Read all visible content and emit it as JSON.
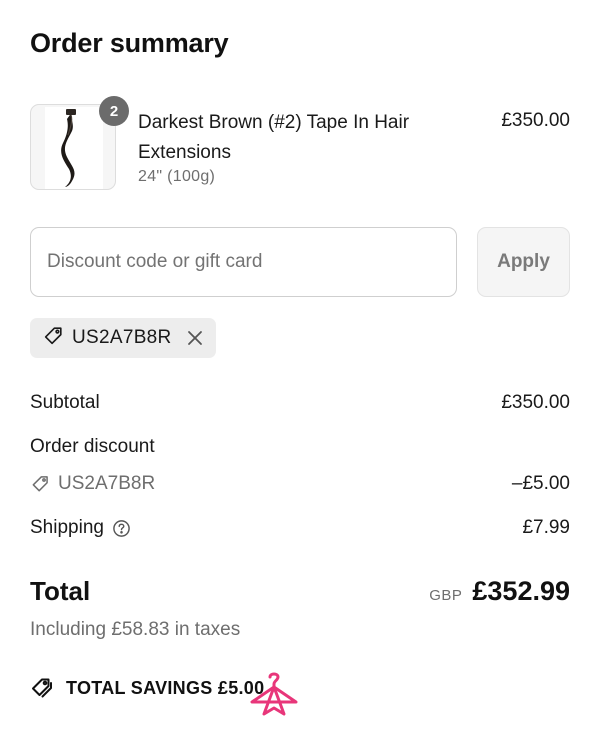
{
  "summary": {
    "title": "Order summary"
  },
  "product": {
    "quantity": "2",
    "name": "Darkest Brown (#2) Tape In Hair Extensions",
    "variant": "24\" (100g)",
    "price": "£350.00"
  },
  "discount": {
    "placeholder": "Discount code or gift card",
    "value": "",
    "apply_label": "Apply",
    "applied_code": "US2A7B8R"
  },
  "rows": {
    "subtotal_label": "Subtotal",
    "subtotal_value": "£350.00",
    "order_discount_label": "Order discount",
    "discount_code": "US2A7B8R",
    "discount_value": "–£5.00",
    "shipping_label": "Shipping",
    "shipping_value": "£7.99"
  },
  "total": {
    "label": "Total",
    "currency": "GBP",
    "amount": "£352.99",
    "taxes_note": "Including £58.83 in taxes"
  },
  "savings": {
    "text": "TOTAL SAVINGS  £5.00"
  },
  "icons": {
    "tag": "tag-icon",
    "close": "close-icon",
    "help": "question-circle-icon",
    "savings_tag": "double-tag-icon",
    "watermark": "hanger-logo-icon"
  },
  "colors": {
    "watermark": "#e8367a",
    "badge": "#6b6b6b"
  }
}
